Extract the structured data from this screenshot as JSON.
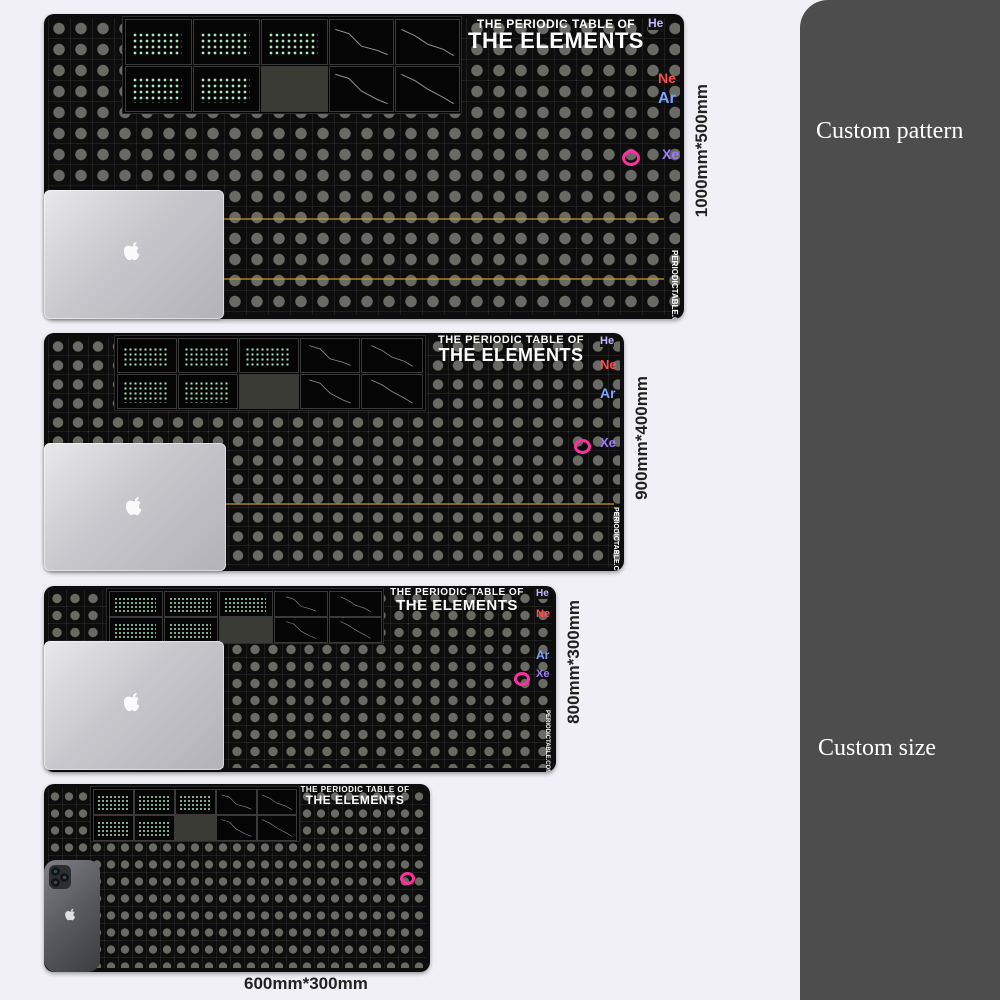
{
  "side": {
    "custom_pattern": "Custom pattern",
    "custom_size": "Custom size"
  },
  "pad_title": {
    "small": "THE PERIODIC TABLE OF",
    "big": "THE ELEMENTS"
  },
  "element_symbols": {
    "he": "He",
    "ne": "Ne",
    "ar": "Ar",
    "xe": "Xe"
  },
  "brand": "PERIODICTABLE.COM",
  "sizes": {
    "s1": "1000mm*500mm",
    "s2": "900mm*400mm",
    "s3": "800mm*300mm",
    "s4": "600mm*300mm"
  },
  "colors": {
    "pad": "#0d0d0d",
    "side_panel": "#4d4d4d",
    "helium": "#c7b6ff",
    "neon": "#ff4b4b",
    "argon": "#7ea4ff",
    "xenon": "#9e7bff"
  }
}
